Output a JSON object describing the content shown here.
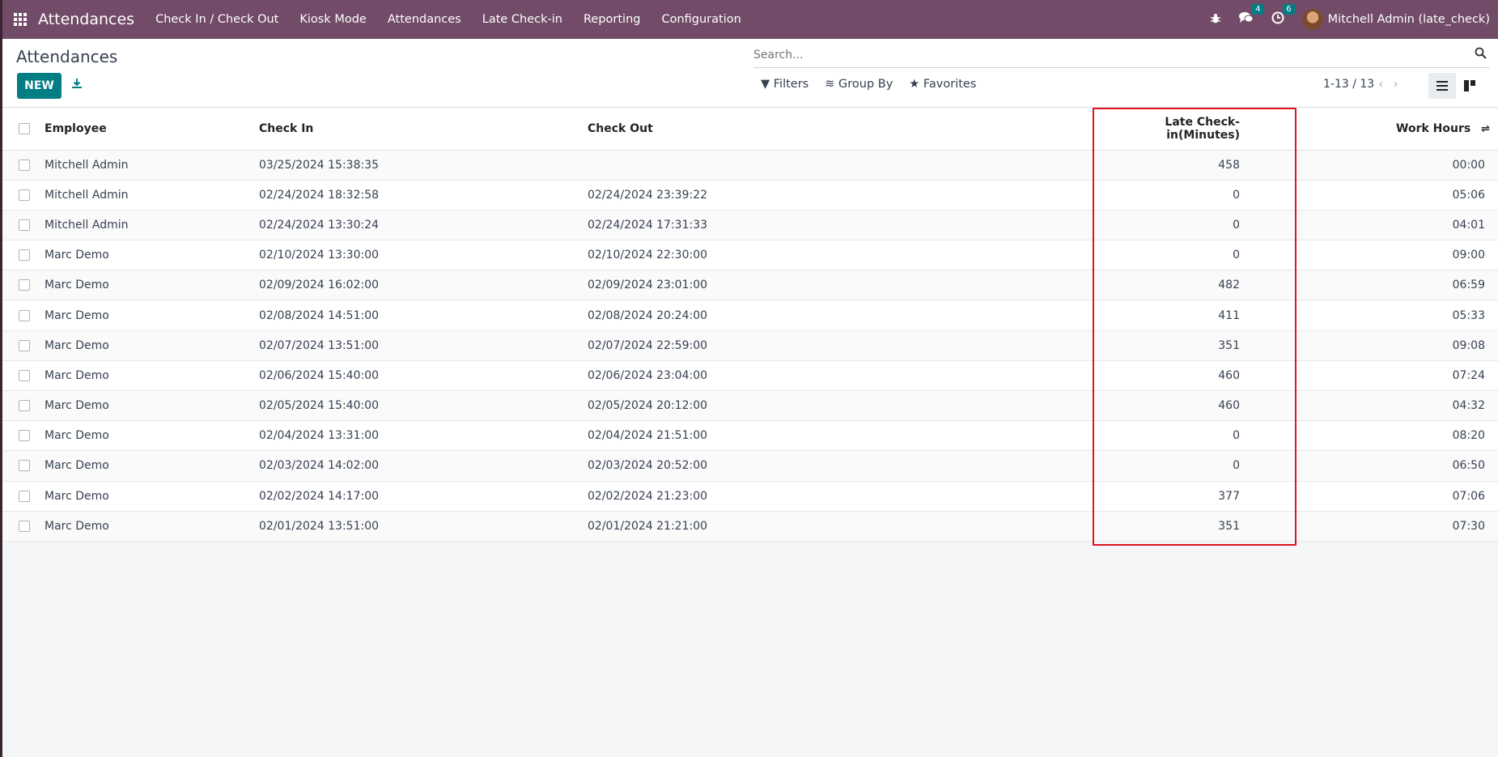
{
  "navbar": {
    "brand": "Attendances",
    "menu": [
      "Check In / Check Out",
      "Kiosk Mode",
      "Attendances",
      "Late Check-in",
      "Reporting",
      "Configuration"
    ],
    "messages_count": "4",
    "activities_count": "6",
    "user": "Mitchell Admin (late_check)"
  },
  "control": {
    "title": "Attendances",
    "new_label": "NEW",
    "search_placeholder": "Search...",
    "filters_label": "Filters",
    "groupby_label": "Group By",
    "favorites_label": "Favorites",
    "pager": "1-13 / 13"
  },
  "table": {
    "headers": {
      "employee": "Employee",
      "check_in": "Check In",
      "check_out": "Check Out",
      "late": "Late Check-in(Minutes)",
      "work_hours": "Work Hours"
    },
    "rows": [
      {
        "employee": "Mitchell Admin",
        "check_in": "03/25/2024 15:38:35",
        "check_out": "",
        "late": "458",
        "work_hours": "00:00"
      },
      {
        "employee": "Mitchell Admin",
        "check_in": "02/24/2024 18:32:58",
        "check_out": "02/24/2024 23:39:22",
        "late": "0",
        "work_hours": "05:06"
      },
      {
        "employee": "Mitchell Admin",
        "check_in": "02/24/2024 13:30:24",
        "check_out": "02/24/2024 17:31:33",
        "late": "0",
        "work_hours": "04:01"
      },
      {
        "employee": "Marc Demo",
        "check_in": "02/10/2024 13:30:00",
        "check_out": "02/10/2024 22:30:00",
        "late": "0",
        "work_hours": "09:00"
      },
      {
        "employee": "Marc Demo",
        "check_in": "02/09/2024 16:02:00",
        "check_out": "02/09/2024 23:01:00",
        "late": "482",
        "work_hours": "06:59"
      },
      {
        "employee": "Marc Demo",
        "check_in": "02/08/2024 14:51:00",
        "check_out": "02/08/2024 20:24:00",
        "late": "411",
        "work_hours": "05:33"
      },
      {
        "employee": "Marc Demo",
        "check_in": "02/07/2024 13:51:00",
        "check_out": "02/07/2024 22:59:00",
        "late": "351",
        "work_hours": "09:08"
      },
      {
        "employee": "Marc Demo",
        "check_in": "02/06/2024 15:40:00",
        "check_out": "02/06/2024 23:04:00",
        "late": "460",
        "work_hours": "07:24"
      },
      {
        "employee": "Marc Demo",
        "check_in": "02/05/2024 15:40:00",
        "check_out": "02/05/2024 20:12:00",
        "late": "460",
        "work_hours": "04:32"
      },
      {
        "employee": "Marc Demo",
        "check_in": "02/04/2024 13:31:00",
        "check_out": "02/04/2024 21:51:00",
        "late": "0",
        "work_hours": "08:20"
      },
      {
        "employee": "Marc Demo",
        "check_in": "02/03/2024 14:02:00",
        "check_out": "02/03/2024 20:52:00",
        "late": "0",
        "work_hours": "06:50"
      },
      {
        "employee": "Marc Demo",
        "check_in": "02/02/2024 14:17:00",
        "check_out": "02/02/2024 21:23:00",
        "late": "377",
        "work_hours": "07:06"
      },
      {
        "employee": "Marc Demo",
        "check_in": "02/01/2024 13:51:00",
        "check_out": "02/01/2024 21:21:00",
        "late": "351",
        "work_hours": "07:30"
      }
    ]
  },
  "colors": {
    "navbar": "#714b67",
    "primary": "#017e84",
    "highlight": "#e0141e"
  }
}
